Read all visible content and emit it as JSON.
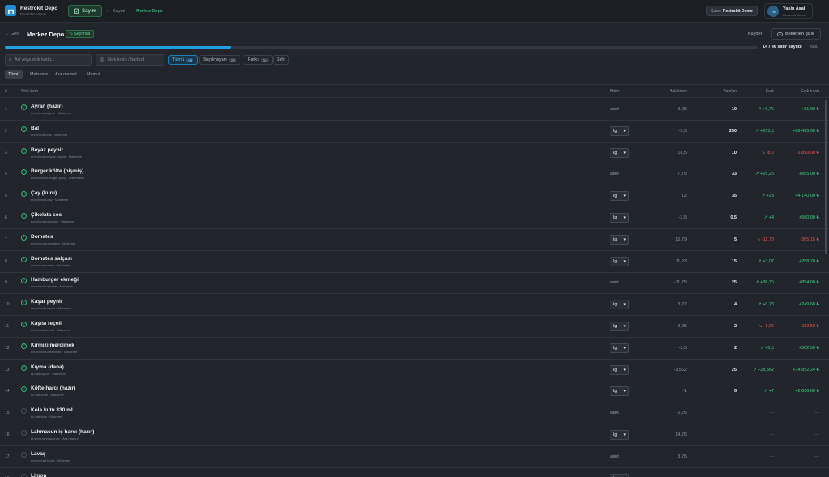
{
  "app": {
    "name": "Restrokit Depo",
    "subtitle": "Envanter sayımı"
  },
  "topbar": {
    "sayim_label": "Sayım",
    "breadcrumb": [
      "Sayım",
      "Merkez Depo"
    ],
    "branch_prefix": "Şube",
    "branch_name": "Restrokit Demo",
    "user_initials": "YA",
    "user_name": "Yasin Asal",
    "user_sub": "Restrokit Demo"
  },
  "page": {
    "back_label": "Geri",
    "title": "Merkez Depo",
    "status": "Sayımda",
    "save_label": "Kaydet",
    "hide_expected_label": "Beklenen gizle",
    "progress_text": "14 / 46 satır sayıldı",
    "progress_percent": "%30",
    "progress_fraction": 0.3
  },
  "search": {
    "name_placeholder": "Ad veya stok kodu...",
    "barcode_placeholder": "Stok kodu / barkod"
  },
  "filters": [
    {
      "label": "Tümü",
      "count": "46"
    },
    {
      "label": "Sayılmayan",
      "count": "30"
    },
    {
      "label": "Farklı",
      "count": "14"
    },
    {
      "label": "Sıfır",
      "count": ""
    }
  ],
  "tabs": [
    "Tümü",
    "Malzeme",
    "Ara mamul",
    "Mamul"
  ],
  "columns": {
    "idx": "#",
    "stock": "Stok kartı",
    "unit": "Birim",
    "expected": "Beklenen",
    "counted": "Sayılan",
    "diff": "Fark",
    "diff_amount": "Fark tutarı"
  },
  "rows": [
    {
      "idx": "1",
      "name": "Ayran (hazır)",
      "sub": "enrich-mat-ayran · Malzeme",
      "unit": "adet",
      "unit_select": false,
      "expected": "3,25",
      "counted": "10",
      "diff": "↗ +6,75",
      "amount": "+81,00 ₺",
      "tone": "pos",
      "done": true
    },
    {
      "idx": "2",
      "name": "Bal",
      "sub": "enrich-mat-bal · Malzeme",
      "unit": "kg",
      "unit_select": true,
      "expected": "-5,5",
      "counted": "250",
      "diff": "↗ +255,5",
      "amount": "+89.425,00 ₺",
      "tone": "pos",
      "done": true
    },
    {
      "idx": "3",
      "name": "Beyaz peynir",
      "sub": "enrich-mat-beyaz-peynir · Malzeme",
      "unit": "kg",
      "unit_select": true,
      "expected": "18,5",
      "counted": "10",
      "diff": "↘ -8,5",
      "amount": "-1.890,00 ₺",
      "tone": "neg",
      "done": true
    },
    {
      "idx": "4",
      "name": "Burger köfte (pişmiş)",
      "sub": "enrich-semi-burger-patty · Ara mamul",
      "unit": "adet",
      "unit_select": false,
      "expected": "7,75",
      "counted": "33",
      "diff": "↗ +25,25",
      "amount": "+855,00 ₺",
      "tone": "pos",
      "done": true
    },
    {
      "idx": "5",
      "name": "Çay (kuru)",
      "sub": "enrich-mat-cay · Malzeme",
      "unit": "kg",
      "unit_select": true,
      "expected": "12",
      "counted": "35",
      "diff": "↗ +23",
      "amount": "+4.140,00 ₺",
      "tone": "pos",
      "done": true
    },
    {
      "idx": "6",
      "name": "Çikolata sos",
      "sub": "enrich-mat-cikolata · Malzeme",
      "unit": "kg",
      "unit_select": true,
      "expected": "-3,5",
      "counted": "0,5",
      "diff": "↗ +4",
      "amount": "+560,00 ₺",
      "tone": "pos",
      "done": true
    },
    {
      "idx": "7",
      "name": "Domates",
      "sub": "enrich-mat-domates · Malzeme",
      "unit": "kg",
      "unit_select": true,
      "expected": "16,79",
      "counted": "5",
      "diff": "↘ -11,79",
      "amount": "-365,15 ₺",
      "tone": "neg",
      "done": true
    },
    {
      "idx": "8",
      "name": "Domates salçası",
      "sub": "enrich-mat-salca · Malzeme",
      "unit": "kg",
      "unit_select": true,
      "expected": "11,93",
      "counted": "15",
      "diff": "↗ +3,07",
      "amount": "+258,70 ₺",
      "tone": "pos",
      "done": true
    },
    {
      "idx": "9",
      "name": "Hamburger ekmeği",
      "sub": "enrich-mat-ekmek · Malzeme",
      "unit": "adet",
      "unit_select": false,
      "expected": "-11,75",
      "counted": "25",
      "diff": "↗ +36,75",
      "amount": "+854,00 ₺",
      "tone": "pos",
      "done": true
    },
    {
      "idx": "10",
      "name": "Kaşar peynir",
      "sub": "enrich-mat-kasar · Malzeme",
      "unit": "kg",
      "unit_select": true,
      "expected": "3,77",
      "counted": "4",
      "diff": "↗ +0,78",
      "amount": "+249,60 ₺",
      "tone": "pos",
      "done": true
    },
    {
      "idx": "11",
      "name": "Kayısı reçeli",
      "sub": "enrich-mat-recel · Malzeme",
      "unit": "kg",
      "unit_select": true,
      "expected": "3,25",
      "counted": "2",
      "diff": "↘ -1,25",
      "amount": "-112,50 ₺",
      "tone": "neg",
      "done": true
    },
    {
      "idx": "12",
      "name": "Kırmızı mercimek",
      "sub": "enrich-mat-mercimek · Malzeme",
      "unit": "kg",
      "unit_select": true,
      "expected": "-3,5",
      "counted": "2",
      "diff": "↗ +5,5",
      "amount": "+302,50 ₺",
      "tone": "pos",
      "done": true
    },
    {
      "idx": "13",
      "name": "Kıyma (dana)",
      "sub": "kt-mat-kiyma · Malzeme",
      "unit": "kg",
      "unit_select": true,
      "expected": "-3,562",
      "counted": "25",
      "diff": "↗ +28,562",
      "amount": "+14.852,24 ₺",
      "tone": "pos",
      "done": true
    },
    {
      "idx": "14",
      "name": "Köfte harcı (hazır)",
      "sub": "kt-mat-kofte · Malzeme",
      "unit": "kg",
      "unit_select": true,
      "expected": "-1",
      "counted": "6",
      "diff": "↗ +7",
      "amount": "+2.660,00 ₺",
      "tone": "pos",
      "done": true
    },
    {
      "idx": "15",
      "name": "Kola kutu 330 ml",
      "sub": "kt-mat-kola · Malzeme",
      "unit": "adet",
      "unit_select": false,
      "expected": "-0,25",
      "counted": "",
      "diff": "—",
      "amount": "—",
      "tone": "dash",
      "done": false
    },
    {
      "idx": "16",
      "name": "Lahmacun iç harcı (hazır)",
      "sub": "kt-semi-lahmacun-ic · Ara mamul",
      "unit": "kg",
      "unit_select": true,
      "expected": "14,25",
      "counted": "",
      "diff": "—",
      "amount": "—",
      "tone": "dash",
      "done": false
    },
    {
      "idx": "17",
      "name": "Lavaş",
      "sub": "enrich-mat-lavas · Malzeme",
      "unit": "adet",
      "unit_select": false,
      "expected": "3,25",
      "counted": "",
      "diff": "—",
      "amount": "—",
      "tone": "dash",
      "done": false
    },
    {
      "idx": "18",
      "name": "Limon",
      "sub": "",
      "unit": "kg",
      "unit_select": true,
      "expected": "",
      "counted": "",
      "diff": "",
      "amount": "",
      "tone": "dash",
      "done": false
    }
  ]
}
